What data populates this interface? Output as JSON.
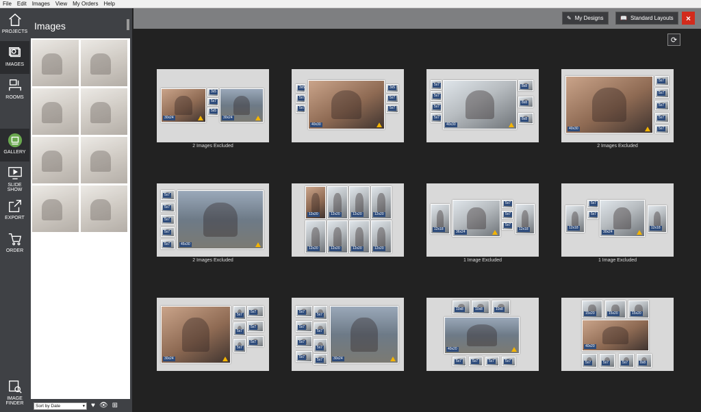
{
  "menu": [
    "File",
    "Edit",
    "Images",
    "View",
    "My Orders",
    "Help"
  ],
  "rail": {
    "items": [
      {
        "name": "projects",
        "label": "PROJECTS"
      },
      {
        "name": "images",
        "label": "IMAGES"
      },
      {
        "name": "rooms",
        "label": "ROOMS"
      },
      {
        "name": "gallery",
        "label": "GALLERY"
      },
      {
        "name": "slideshow",
        "label": "SLIDE SHOW"
      },
      {
        "name": "export",
        "label": "EXPORT"
      },
      {
        "name": "order",
        "label": "ORDER"
      },
      {
        "name": "imagefinder",
        "label": "IMAGE\nFINDER"
      }
    ]
  },
  "panel": {
    "title": "Images",
    "sort_label": "Sort by Date"
  },
  "topbar": {
    "my_designs": "My Designs",
    "standard_layouts": "Standard Layouts",
    "close": "×"
  },
  "cards": [
    {
      "caption": "2 Images Excluded",
      "labels": [
        "30x24",
        "3x5",
        "5x7",
        "5x5",
        "30x24"
      ]
    },
    {
      "caption": "",
      "labels": [
        "3x5",
        "5x7",
        "5x7",
        "40x30",
        "3x5",
        "5x7",
        "5x7"
      ]
    },
    {
      "caption": "",
      "labels": [
        "5x7",
        "5x7",
        "5x7",
        "5x7",
        "40x30",
        "8x8",
        "8x8",
        "8x8"
      ]
    },
    {
      "caption": "2 Images Excluded",
      "labels": [
        "40x30",
        "5x7",
        "5x7",
        "5x7",
        "5x7",
        "5x7"
      ]
    },
    {
      "caption": "2 Images Excluded",
      "labels": [
        "5x7",
        "5x7",
        "5x7",
        "5x7",
        "5x7",
        "45x30"
      ]
    },
    {
      "caption": "",
      "labels": [
        "12x20",
        "12x20",
        "12x20",
        "12x20",
        "12x20",
        "12x20",
        "12x20",
        "12x20"
      ]
    },
    {
      "caption": "1 Image Excluded",
      "labels": [
        "12x18",
        "36x24",
        "5x7",
        "5x7",
        "5x7",
        "12x18"
      ]
    },
    {
      "caption": "1 Image Excluded",
      "labels": [
        "12x18",
        "5x7",
        "30x24",
        "5x7",
        "12x18"
      ]
    },
    {
      "caption": "",
      "labels": [
        "30x24",
        "5x7",
        "5x7",
        "5x7",
        "5x7",
        "5x7",
        "5x7"
      ]
    },
    {
      "caption": "",
      "labels": [
        "5x7",
        "5x7",
        "5x7",
        "5x7",
        "5x7",
        "5x7",
        "5x7",
        "5x7",
        "30x24"
      ]
    },
    {
      "caption": "",
      "labels": [
        "10x8",
        "10x8",
        "10x8",
        "40x20",
        "5x7",
        "5x7",
        "5x7",
        "5x7"
      ]
    },
    {
      "caption": "",
      "labels": [
        "15x20",
        "15x20",
        "15x20",
        "40x20",
        "5x7",
        "5x7",
        "5x7",
        "8x8"
      ]
    }
  ],
  "colors": {
    "accent_close": "#d22b1c",
    "warning": "#f4b400",
    "size_badge": "#2c4a7a"
  }
}
